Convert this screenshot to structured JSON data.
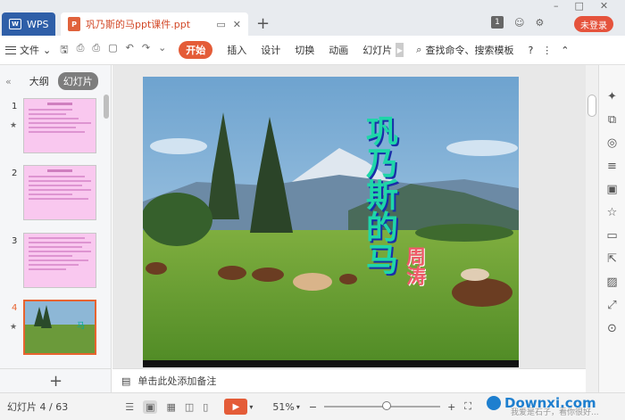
{
  "titlebar": {
    "wps_tab": "WPS",
    "doc_tab": "巩乃斯的马ppt课件.ppt",
    "new_tab": "+",
    "badge": "1",
    "login": "未登录",
    "window_controls": [
      "–",
      "□",
      "✕"
    ]
  },
  "ribbon": {
    "file": "文件",
    "tabs": [
      "开始",
      "插入",
      "设计",
      "切换",
      "动画",
      "幻灯片"
    ],
    "search": "查找命令、搜索模板",
    "help": "?",
    "more": "⋮"
  },
  "left_panel": {
    "collapse": "«",
    "outline_tab": "大纲",
    "slides_tab": "幻灯片",
    "thumbnails": [
      {
        "num": "1",
        "star": "★",
        "active": false
      },
      {
        "num": "2",
        "star": "",
        "active": false
      },
      {
        "num": "3",
        "star": "",
        "active": false
      },
      {
        "num": "4",
        "star": "★",
        "active": true
      }
    ],
    "add": "+"
  },
  "slide": {
    "title": "巩乃斯的马",
    "author": "周涛"
  },
  "notes": {
    "placeholder": "单击此处添加备注"
  },
  "statusbar": {
    "slide_count": "幻灯片 4 / 63",
    "zoom": "51%",
    "zoom_fraction": 0.51
  },
  "watermark": {
    "brand": "Downxi.com",
    "tagline": "我爱是石子，看你很好..."
  },
  "colors": {
    "accent": "#e45c38",
    "login": "#e5533c",
    "wps_blue": "#2f5fa8",
    "thumb_pink": "#f9c8ef",
    "watermark": "#1e7fcf"
  }
}
